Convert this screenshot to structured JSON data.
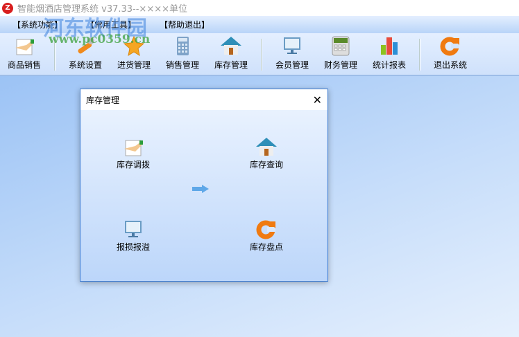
{
  "window": {
    "title": "智能烟酒店管理系统 v37.33--××××单位"
  },
  "menu": [
    "【系统功能】",
    "【常用工具】",
    "【帮助退出】"
  ],
  "toolbar": [
    {
      "label": "商品销售",
      "icon": "hand-note-icon"
    },
    {
      "label": "系统设置",
      "icon": "wrench-icon"
    },
    {
      "label": "进货管理",
      "icon": "star-icon"
    },
    {
      "label": "销售管理",
      "icon": "calculator-icon"
    },
    {
      "label": "库存管理",
      "icon": "house-icon"
    },
    {
      "label": "会员管理",
      "icon": "monitor-icon"
    },
    {
      "label": "财务管理",
      "icon": "calculator-icon"
    },
    {
      "label": "统计报表",
      "icon": "bar-chart-icon"
    },
    {
      "label": "退出系统",
      "icon": "refresh-icon"
    }
  ],
  "dialog": {
    "title": "库存管理",
    "close": "✕",
    "items": [
      "库存调拨",
      "库存查询",
      "报损报溢",
      "库存盘点"
    ]
  },
  "watermark": {
    "text": "河东软件园",
    "url": "www.pc0359.cn"
  }
}
